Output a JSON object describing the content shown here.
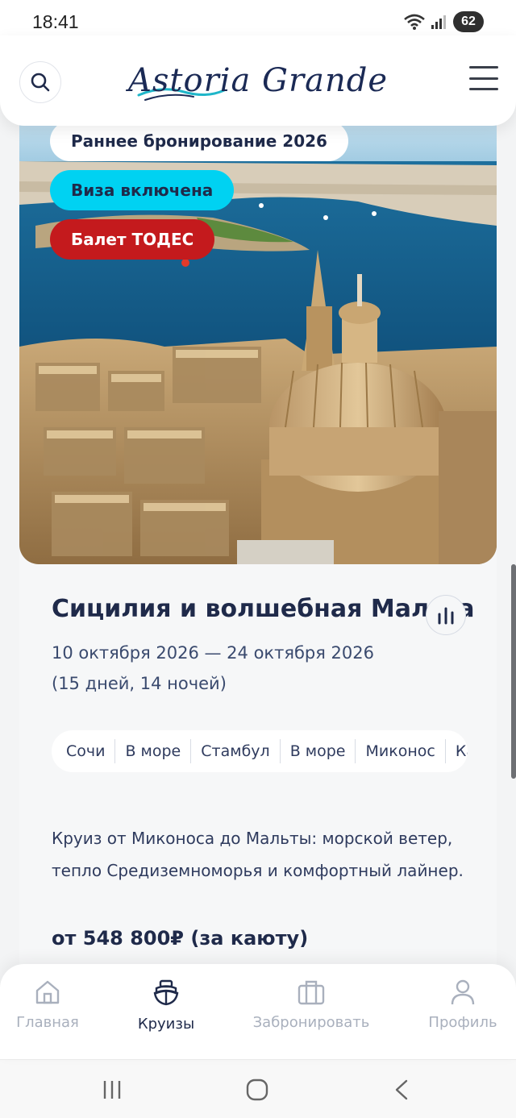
{
  "status_bar": {
    "time": "18:41",
    "battery": "62"
  },
  "header": {
    "logo": "Astoria Grande",
    "icons": [
      "search-icon",
      "menu-icon"
    ]
  },
  "cruise": {
    "badges": [
      {
        "label": "Раннее бронирование 2026",
        "color": "#ffffff"
      },
      {
        "label": "Виза включена",
        "color": "#00d2f2"
      },
      {
        "label": "Балет ТОДЕС",
        "color": "#c41a1d"
      }
    ],
    "title": "Сицилия и волшебная Мальта",
    "dates": "10 октября 2026 — 24 октября 2026",
    "duration": "(15 дней, 14 ночей)",
    "route": [
      "Сочи",
      "В море",
      "Стамбул",
      "В море",
      "Миконос",
      "Ка"
    ],
    "description": "Круиз от Миконоса до Мальты: морской ветер, тепло Средиземноморья и комфортный лайнер.",
    "price": "от 548 800₽ (за каюту)"
  },
  "bottom_nav": {
    "items": [
      {
        "label": "Главная",
        "icon": "home-icon",
        "active": false
      },
      {
        "label": "Круизы",
        "icon": "ship-icon",
        "active": true
      },
      {
        "label": "Забронировать",
        "icon": "suitcase-icon",
        "active": false
      },
      {
        "label": "Профиль",
        "icon": "profile-icon",
        "active": false
      }
    ]
  },
  "colors": {
    "primary_text": "#1f2a4a",
    "accent_cyan": "#00d2f2",
    "accent_red": "#c41a1d",
    "inactive": "#a9b0bd"
  }
}
